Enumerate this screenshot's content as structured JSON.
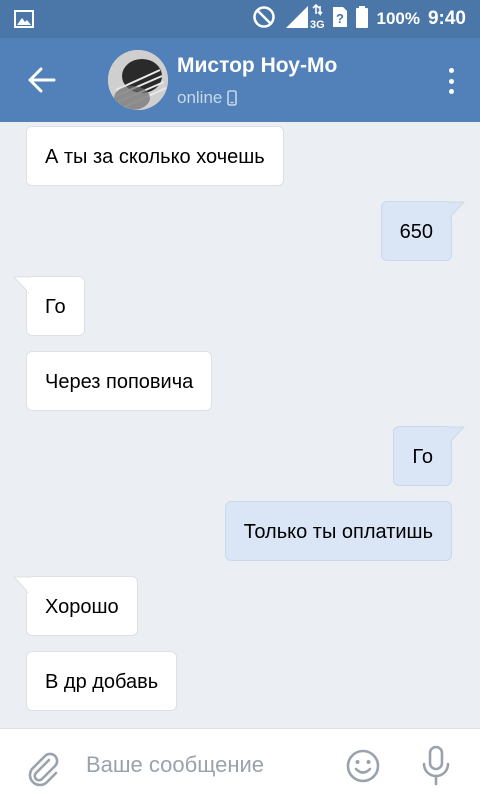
{
  "status_bar": {
    "battery": "100%",
    "time": "9:40",
    "network": "3G",
    "icons": [
      "image-icon",
      "do-not-disturb-icon",
      "signal-icon",
      "sim-unknown-icon",
      "battery-icon"
    ]
  },
  "header": {
    "name": "Мистор Ноу-Мо",
    "status": "online",
    "icons": {
      "back": "arrow-left-icon",
      "mobile": "phone-icon",
      "more": "more-vertical-icon"
    }
  },
  "messages": [
    {
      "side": "in",
      "text": "А ты за сколько хочешь"
    },
    {
      "side": "out",
      "text": "650"
    },
    {
      "side": "in",
      "text": "Го"
    },
    {
      "side": "in",
      "text": "Через поповича"
    },
    {
      "side": "out",
      "text": "Го"
    },
    {
      "side": "out",
      "text": "Только ты оплатишь"
    },
    {
      "side": "in",
      "text": "Хорошо"
    },
    {
      "side": "in",
      "text": "В др добавь"
    }
  ],
  "composer": {
    "placeholder": "Ваше сообщение",
    "value": "",
    "icons": {
      "attach": "paperclip-icon",
      "emoji": "smile-icon",
      "voice": "microphone-icon"
    }
  },
  "colors": {
    "statusbar": "#4a76a8",
    "header": "#5181b8",
    "chat_background": "#ebeff4",
    "incoming_bubble": "#ffffff",
    "outgoing_bubble": "#dae6f6",
    "icon_gray": "#99a2ad"
  }
}
